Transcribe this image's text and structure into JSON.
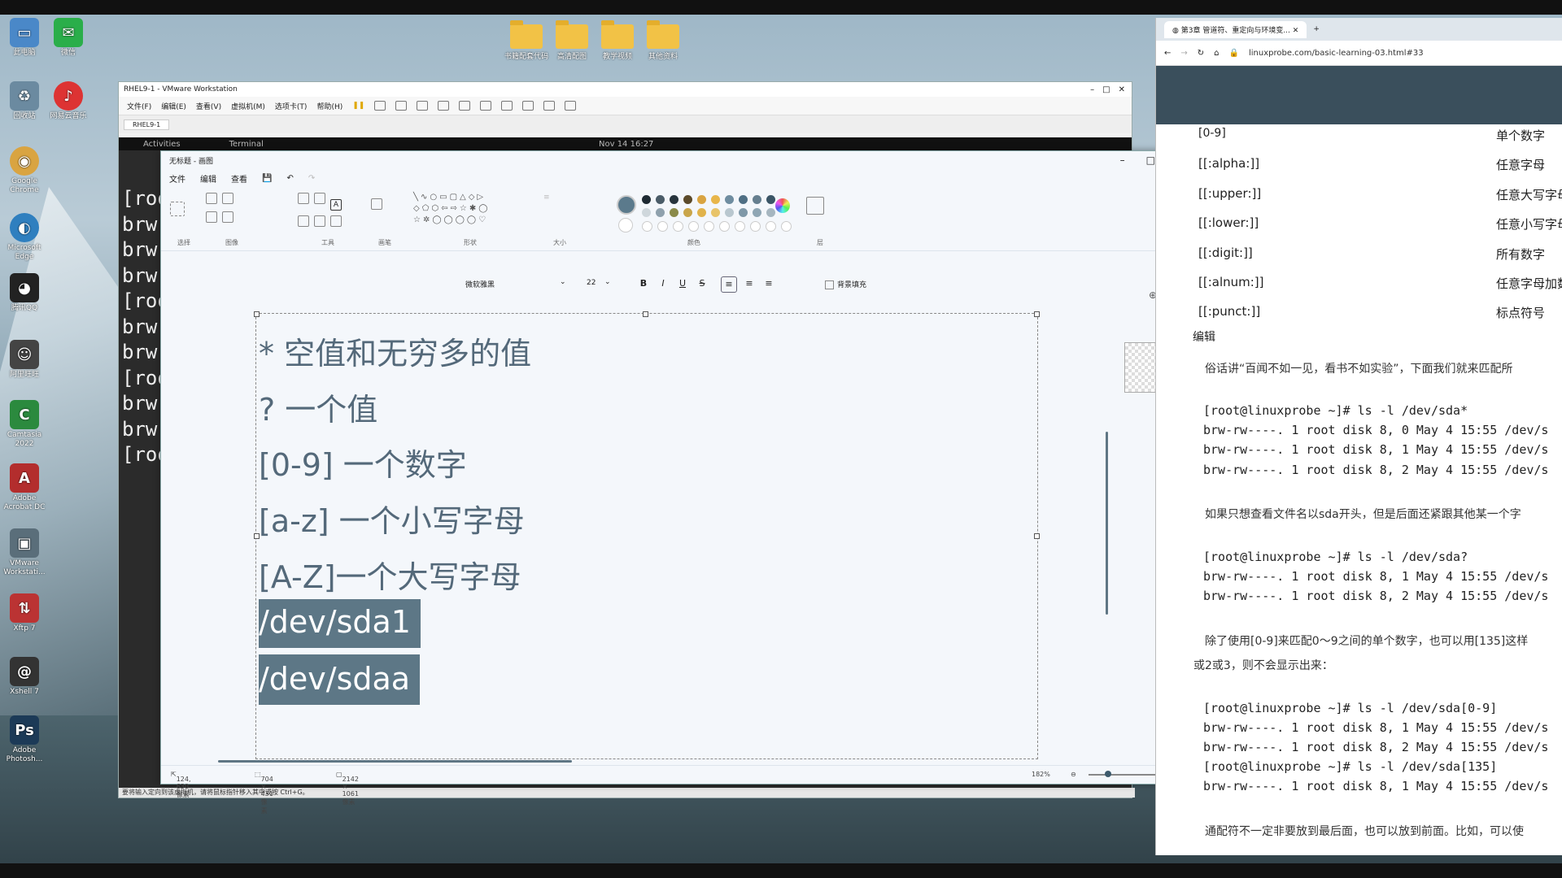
{
  "desktop": {
    "icons_left": [
      {
        "label": "此电脑",
        "glyph": "▭",
        "color": "#4a88c8"
      },
      {
        "label": "回收站",
        "glyph": "♻",
        "color": "#6b8aa0"
      },
      {
        "label": "Google Chrome",
        "glyph": "◉",
        "color": "#d9a441"
      },
      {
        "label": "Microsoft Edge",
        "glyph": "◐",
        "color": "#2f7fbf"
      },
      {
        "label": "腾讯QQ",
        "glyph": "◕",
        "color": "#222"
      },
      {
        "label": "阿里旺旺",
        "glyph": "☺",
        "color": "#444"
      },
      {
        "label": "Camtasia 2022",
        "glyph": "C",
        "color": "#2b8a3e"
      },
      {
        "label": "Adobe Acrobat DC",
        "glyph": "A",
        "color": "#b32d2d"
      },
      {
        "label": "VMware Workstati...",
        "glyph": "▣",
        "color": "#5a6e7a"
      },
      {
        "label": "Xftp 7",
        "glyph": "⇅",
        "color": "#b33"
      },
      {
        "label": "Xshell 7",
        "glyph": "@",
        "color": "#333"
      },
      {
        "label": "Adobe Photosh...",
        "glyph": "Ps",
        "color": "#1c3a57"
      }
    ],
    "icons_col2": [
      {
        "label": "微信",
        "glyph": "✉",
        "color": "#2aae4a"
      },
      {
        "label": "网易云音乐",
        "glyph": "♪",
        "color": "#d33"
      }
    ],
    "folders": [
      {
        "label": "书籍配套代码"
      },
      {
        "label": "高清配图"
      },
      {
        "label": "教学视频"
      },
      {
        "label": "其他资料"
      }
    ]
  },
  "vmware": {
    "title": "RHEL9-1 - VMware Workstation",
    "menu": [
      "文件(F)",
      "编辑(E)",
      "查看(V)",
      "虚拟机(M)",
      "选项卡(T)",
      "帮助(H)"
    ],
    "tab": "RHEL9-1",
    "activities": "Activities",
    "terminal_app": "Terminal",
    "clock": "Nov 14 16:27",
    "terminal_lines": [
      "[roo",
      "brw-",
      "brw-",
      "brw-",
      "[roo",
      "brw-",
      "brw-",
      "[roo",
      "brw-",
      "brw-",
      "[roo"
    ],
    "status": "要将输入定向到该虚拟机，请将鼠标指针移入其中或按 Ctrl+G。"
  },
  "paint": {
    "title": "无标题 - 画图",
    "menu": [
      "文件",
      "编辑",
      "查看"
    ],
    "groups": {
      "select": "选择",
      "image": "图像",
      "tools": "工具",
      "brush": "画笔",
      "shapes": "形状",
      "size": "大小",
      "colors": "颜色",
      "layers": "层"
    },
    "font": "微软雅黑",
    "font_size": "22",
    "bold": "B",
    "italic": "I",
    "underline": "U",
    "strike": "S",
    "fill_label": "背景填充",
    "lines": [
      "* 空值和无穷多的值",
      "? 一个值",
      "[0-9] 一个数字",
      "[a-z] 一个小写字母",
      "[A-Z]一个大写字母",
      "/dev/sda1",
      "/dev/sdaa"
    ],
    "status": {
      "cursor": "124, 630像素",
      "selection": "704 × 431像素",
      "canvas": "2142 × 1061像素",
      "zoom": "182%"
    },
    "palette": [
      "#1e2a33",
      "#4a5c68",
      "#27343d",
      "#5b4a2a",
      "#d9a441",
      "#e8b64a",
      "#6f8da0",
      "#4f6f84",
      "#667f8f",
      "#3a5566"
    ],
    "palette2": [
      "#cfd7dc",
      "#8fa1ad",
      "#8a8a4a",
      "#c9a54a",
      "#e1b34b",
      "#e8c46a",
      "#b9c7cf",
      "#7f98a8",
      "#8fa6b4",
      "#a6b6c0"
    ],
    "current_color": "#5b7a8c"
  },
  "browser": {
    "tab_title": "第3章 管道符、重定向与环境变...",
    "url": "linuxprobe.com/basic-learning-03.html#33",
    "table": [
      {
        "left": "[0-9]",
        "right": "单个数字"
      },
      {
        "left": "[[:alpha:]]",
        "right": "任意字母"
      },
      {
        "left": "[[:upper:]]",
        "right": "任意大写字母"
      },
      {
        "left": "[[:lower:]]",
        "right": "任意小写字母"
      },
      {
        "left": "[[:digit:]]",
        "right": "所有数字"
      },
      {
        "left": "[[:alnum:]]",
        "right": "任意字母加数字"
      },
      {
        "left": "[[:punct:]]",
        "right": "标点符号"
      }
    ],
    "edit_label": "编辑",
    "p1": "俗话讲“百闻不如一见，看书不如实验”，下面我们就来匹配所",
    "code1": [
      "[root@linuxprobe ~]# ls -l /dev/sda*",
      "brw-rw----. 1 root disk 8, 0 May 4 15:55 /dev/s",
      "brw-rw----. 1 root disk 8, 1 May 4 15:55 /dev/s",
      "brw-rw----. 1 root disk 8, 2 May 4 15:55 /dev/s"
    ],
    "p2": "如果只想查看文件名以sda开头，但是后面还紧跟其他某一个字",
    "code2": [
      "[root@linuxprobe ~]# ls -l /dev/sda?",
      "brw-rw----. 1 root disk 8, 1 May 4 15:55 /dev/s",
      "brw-rw----. 1 root disk 8, 2 May 4 15:55 /dev/s"
    ],
    "p3a": "除了使用[0-9]来匹配0～9之间的单个数字，也可以用[135]这样",
    "p3b": "或2或3，则不会显示出来：",
    "code3": [
      "[root@linuxprobe ~]# ls -l /dev/sda[0-9]",
      "brw-rw----. 1 root disk 8, 1 May 4 15:55 /dev/s",
      "brw-rw----. 1 root disk 8, 2 May 4 15:55 /dev/s",
      "[root@linuxprobe ~]# ls -l /dev/sda[135]",
      "brw-rw----. 1 root disk 8, 1 May 4 15:55 /dev/s"
    ],
    "p4": "通配符不一定非要放到最后面，也可以放到前面。比如，可以使"
  }
}
